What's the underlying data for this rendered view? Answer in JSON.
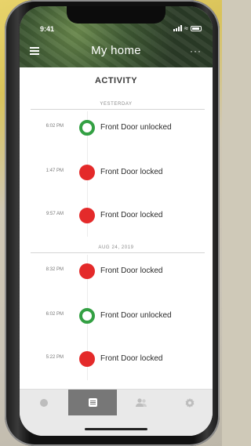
{
  "status": {
    "time": "9:41"
  },
  "header": {
    "title": "My home",
    "more": "···"
  },
  "section_title": "ACTIVITY",
  "groups": [
    {
      "date": "YESTERDAY",
      "events": [
        {
          "time": "6:02 PM",
          "message": "Front Door unlocked",
          "state": "unlocked"
        },
        {
          "time": "1:47 PM",
          "message": "Front Door locked",
          "state": "locked"
        },
        {
          "time": "9:57 AM",
          "message": "Front Door locked",
          "state": "locked"
        }
      ]
    },
    {
      "date": "AUG 24, 2019",
      "events": [
        {
          "time": "8:32 PM",
          "message": "Front Door locked",
          "state": "locked"
        },
        {
          "time": "6:02 PM",
          "message": "Front Door unlocked",
          "state": "unlocked"
        },
        {
          "time": "5:22 PM",
          "message": "Front Door locked",
          "state": "locked"
        }
      ]
    }
  ],
  "tabs": [
    {
      "icon": "home-dot-icon",
      "active": false
    },
    {
      "icon": "activity-list-icon",
      "active": true
    },
    {
      "icon": "users-icon",
      "active": false
    },
    {
      "icon": "settings-gear-icon",
      "active": false
    }
  ],
  "colors": {
    "locked": "#e42a2a",
    "unlocked": "#33a043",
    "active_tab": "#777777"
  }
}
